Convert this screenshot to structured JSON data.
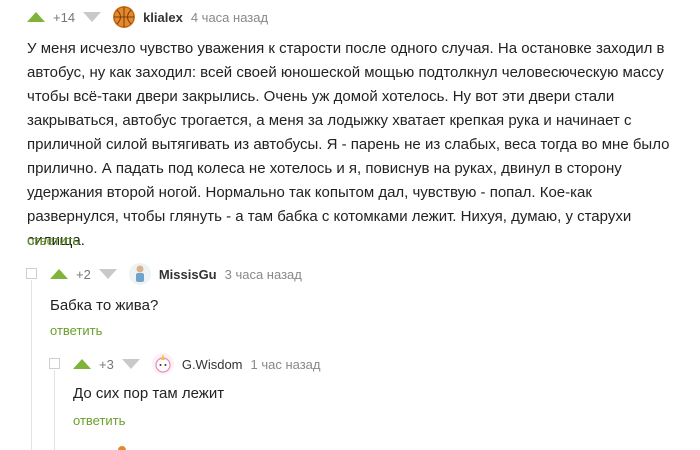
{
  "comments": [
    {
      "rating": "+14",
      "username": "klialex",
      "time": "4 часа назад",
      "avatar_icon": "orange-basketball-avatar",
      "text": "У меня исчезло чувство уважения к старости после одного случая. На остановке заходил в автобус, ну как заходил: всей своей юношеской мощью подтолкнул человесюческую массу чтобы всё-таки двери закрылись. Очень уж домой хотелось. Ну вот эти двери стали закрываться, автобус трогается, а меня за лодыжку хватает крепкая рука и начинает с приличной силой вытягивать из автобусы. Я - парень не из слабых, веса тогда во мне было прилично. А падать под колеса не хотелось и я, повиснув на руках, двинул в сторону удержания второй ногой. Нормально так копытом дал, чувствую - попал. Кое-как развернулся, чтобы глянуть - а там бабка с котомками лежит. Нихуя, думаю, у старухи силища.",
      "reply": "ответить"
    },
    {
      "rating": "+2",
      "username": "MissisGu",
      "time": "3 часа назад",
      "avatar_icon": "figure-avatar",
      "text": "Бабка то жива?",
      "reply": "ответить"
    },
    {
      "rating": "+3",
      "username": "G.Wisdom",
      "time": "1 час назад",
      "avatar_icon": "unicorn-avatar",
      "text": "До сих пор там лежит",
      "reply": "ответить"
    }
  ],
  "colors": {
    "upvote": "#7fb33a",
    "downvote": "#c9c9c9",
    "reply_link": "#6a9f2a",
    "thread_line": "#e3e3e3"
  }
}
